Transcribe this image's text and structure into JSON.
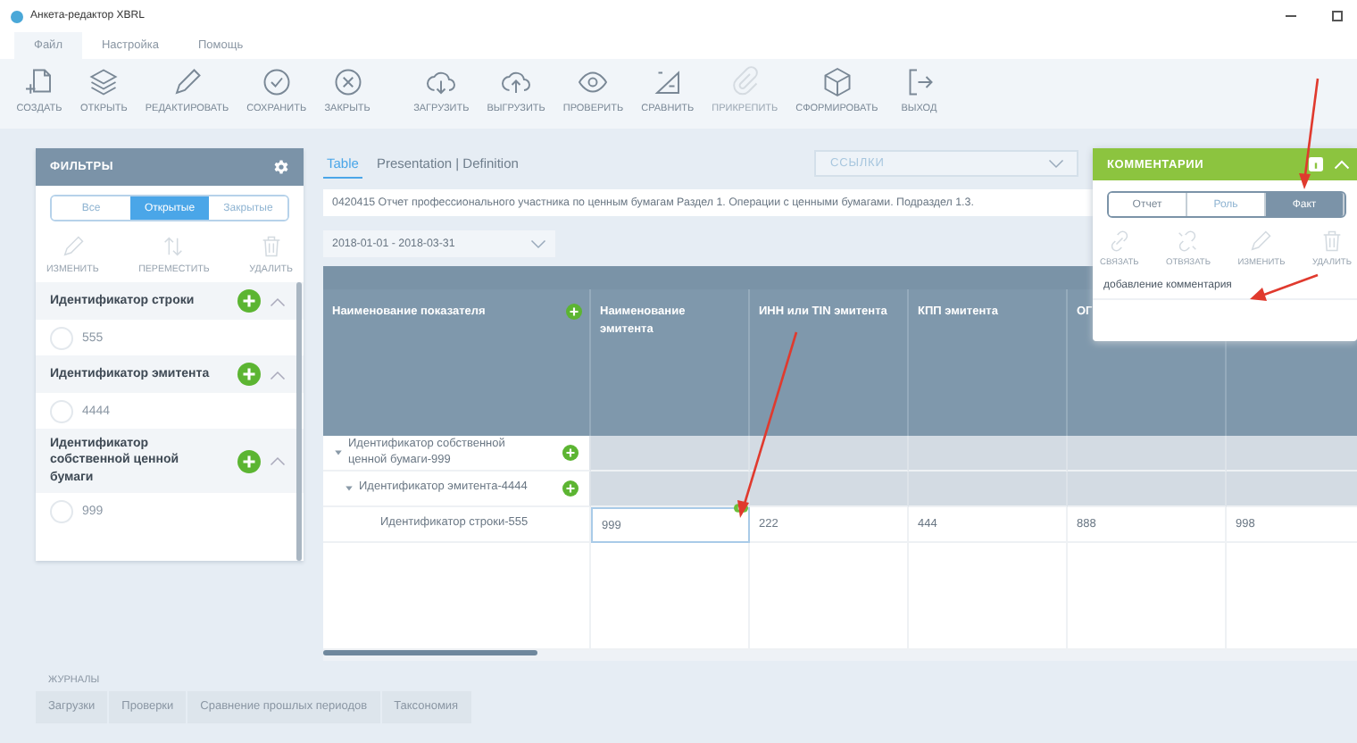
{
  "window": {
    "title": "Анкета-редактор XBRL"
  },
  "menu": [
    {
      "label": "Файл",
      "selected": true
    },
    {
      "label": "Настройка",
      "selected": false
    },
    {
      "label": "Помощь",
      "selected": false
    }
  ],
  "toolbar": {
    "groups": [
      [
        {
          "label": "СОЗДАТЬ",
          "disabled": false
        },
        {
          "label": "ОТКРЫТЬ",
          "disabled": false
        },
        {
          "label": "РЕДАКТИРОВАТЬ",
          "disabled": false
        },
        {
          "label": "СОХРАНИТЬ",
          "disabled": false
        },
        {
          "label": "ЗАКРЫТЬ",
          "disabled": false
        }
      ],
      [
        {
          "label": "ЗАГРУЗИТЬ",
          "disabled": false
        },
        {
          "label": "ВЫГРУЗИТЬ",
          "disabled": false
        },
        {
          "label": "ПРОВЕРИТЬ",
          "disabled": false
        },
        {
          "label": "СРАВНИТЬ",
          "disabled": false
        },
        {
          "label": "ПРИКРЕПИТЬ",
          "disabled": true
        },
        {
          "label": "СФОРМИРОВАТЬ",
          "disabled": false
        },
        {
          "label": "ВЫХОД",
          "disabled": false
        }
      ]
    ]
  },
  "filters": {
    "title": "ФИЛЬТРЫ",
    "segments": [
      {
        "label": "Все",
        "selected": false,
        "disabled": true
      },
      {
        "label": "Открытые",
        "selected": true,
        "disabled": false
      },
      {
        "label": "Закрытые",
        "selected": false,
        "disabled": true
      }
    ],
    "actions": [
      {
        "label": "ИЗМЕНИТЬ",
        "disabled": true
      },
      {
        "label": "ПЕРЕМЕСТИТЬ",
        "disabled": true
      },
      {
        "label": "УДАЛИТЬ",
        "disabled": true
      }
    ],
    "groups": [
      {
        "title": "Идентификатор строки",
        "expanded": true,
        "values": [
          {
            "label": "555",
            "checked": false
          }
        ]
      },
      {
        "title": "Идентификатор эмитента",
        "expanded": true,
        "values": [
          {
            "label": "4444",
            "checked": false
          }
        ]
      },
      {
        "title": "Идентификатор собственной ценной бумаги",
        "expanded": true,
        "values": [
          {
            "label": "999",
            "checked": false
          }
        ]
      }
    ]
  },
  "view_tabs": [
    {
      "label": "Table",
      "selected": true
    },
    {
      "label": "Presentation | Definition",
      "selected": false
    }
  ],
  "links_dropdown": {
    "placeholder": "ССЫЛКИ"
  },
  "report_title": "0420415 Отчет профессионального участника по ценным бумагам Раздел 1. Операции с ценными бумагами. Подраздел 1.3.",
  "period": {
    "value": "2018-01-01 - 2018-03-31"
  },
  "table": {
    "columns": [
      "Наименование показателя",
      "Наименование эмитента",
      "ИНН или TIN эмитента",
      "КПП эмитента",
      "ОГ"
    ],
    "rows": [
      {
        "kind": "group",
        "label": "Идентификатор собственной ценной бумаги-999",
        "expanded": true,
        "children": [
          {
            "kind": "group",
            "label": "Идентификатор эмитента-4444",
            "expanded": true,
            "children": [
              {
                "kind": "data",
                "label": "Идентификатор строки-555",
                "cells": [
                  {
                    "value": "999",
                    "selected": true,
                    "commented": true
                  },
                  {
                    "value": "222",
                    "selected": false,
                    "commented": false
                  },
                  {
                    "value": "444",
                    "selected": false,
                    "commented": false
                  },
                  {
                    "value": "888",
                    "selected": false,
                    "commented": false
                  },
                  {
                    "value": "998",
                    "selected": false,
                    "commented": false
                  }
                ]
              }
            ]
          }
        ]
      }
    ]
  },
  "comments": {
    "title": "КОММЕНТАРИИ",
    "expanded": true,
    "segments": [
      {
        "label": "Отчет",
        "selected": false,
        "disabled": false
      },
      {
        "label": "Роль",
        "selected": false,
        "disabled": true
      },
      {
        "label": "Факт",
        "selected": true,
        "disabled": false
      }
    ],
    "actions": [
      {
        "label": "СВЯЗАТЬ",
        "disabled": true
      },
      {
        "label": "ОТВЯЗАТЬ",
        "disabled": true
      },
      {
        "label": "ИЗМЕНИТЬ",
        "disabled": true
      },
      {
        "label": "УДАЛИТЬ",
        "disabled": true
      }
    ],
    "items": [
      "добавление комментария"
    ]
  },
  "journals": {
    "title": "ЖУРНАЛЫ",
    "tabs": [
      {
        "label": "Загрузки",
        "selected": false
      },
      {
        "label": "Проверки",
        "selected": false
      },
      {
        "label": "Сравнение прошлых периодов",
        "selected": false
      },
      {
        "label": "Таксономия",
        "selected": false
      }
    ]
  }
}
